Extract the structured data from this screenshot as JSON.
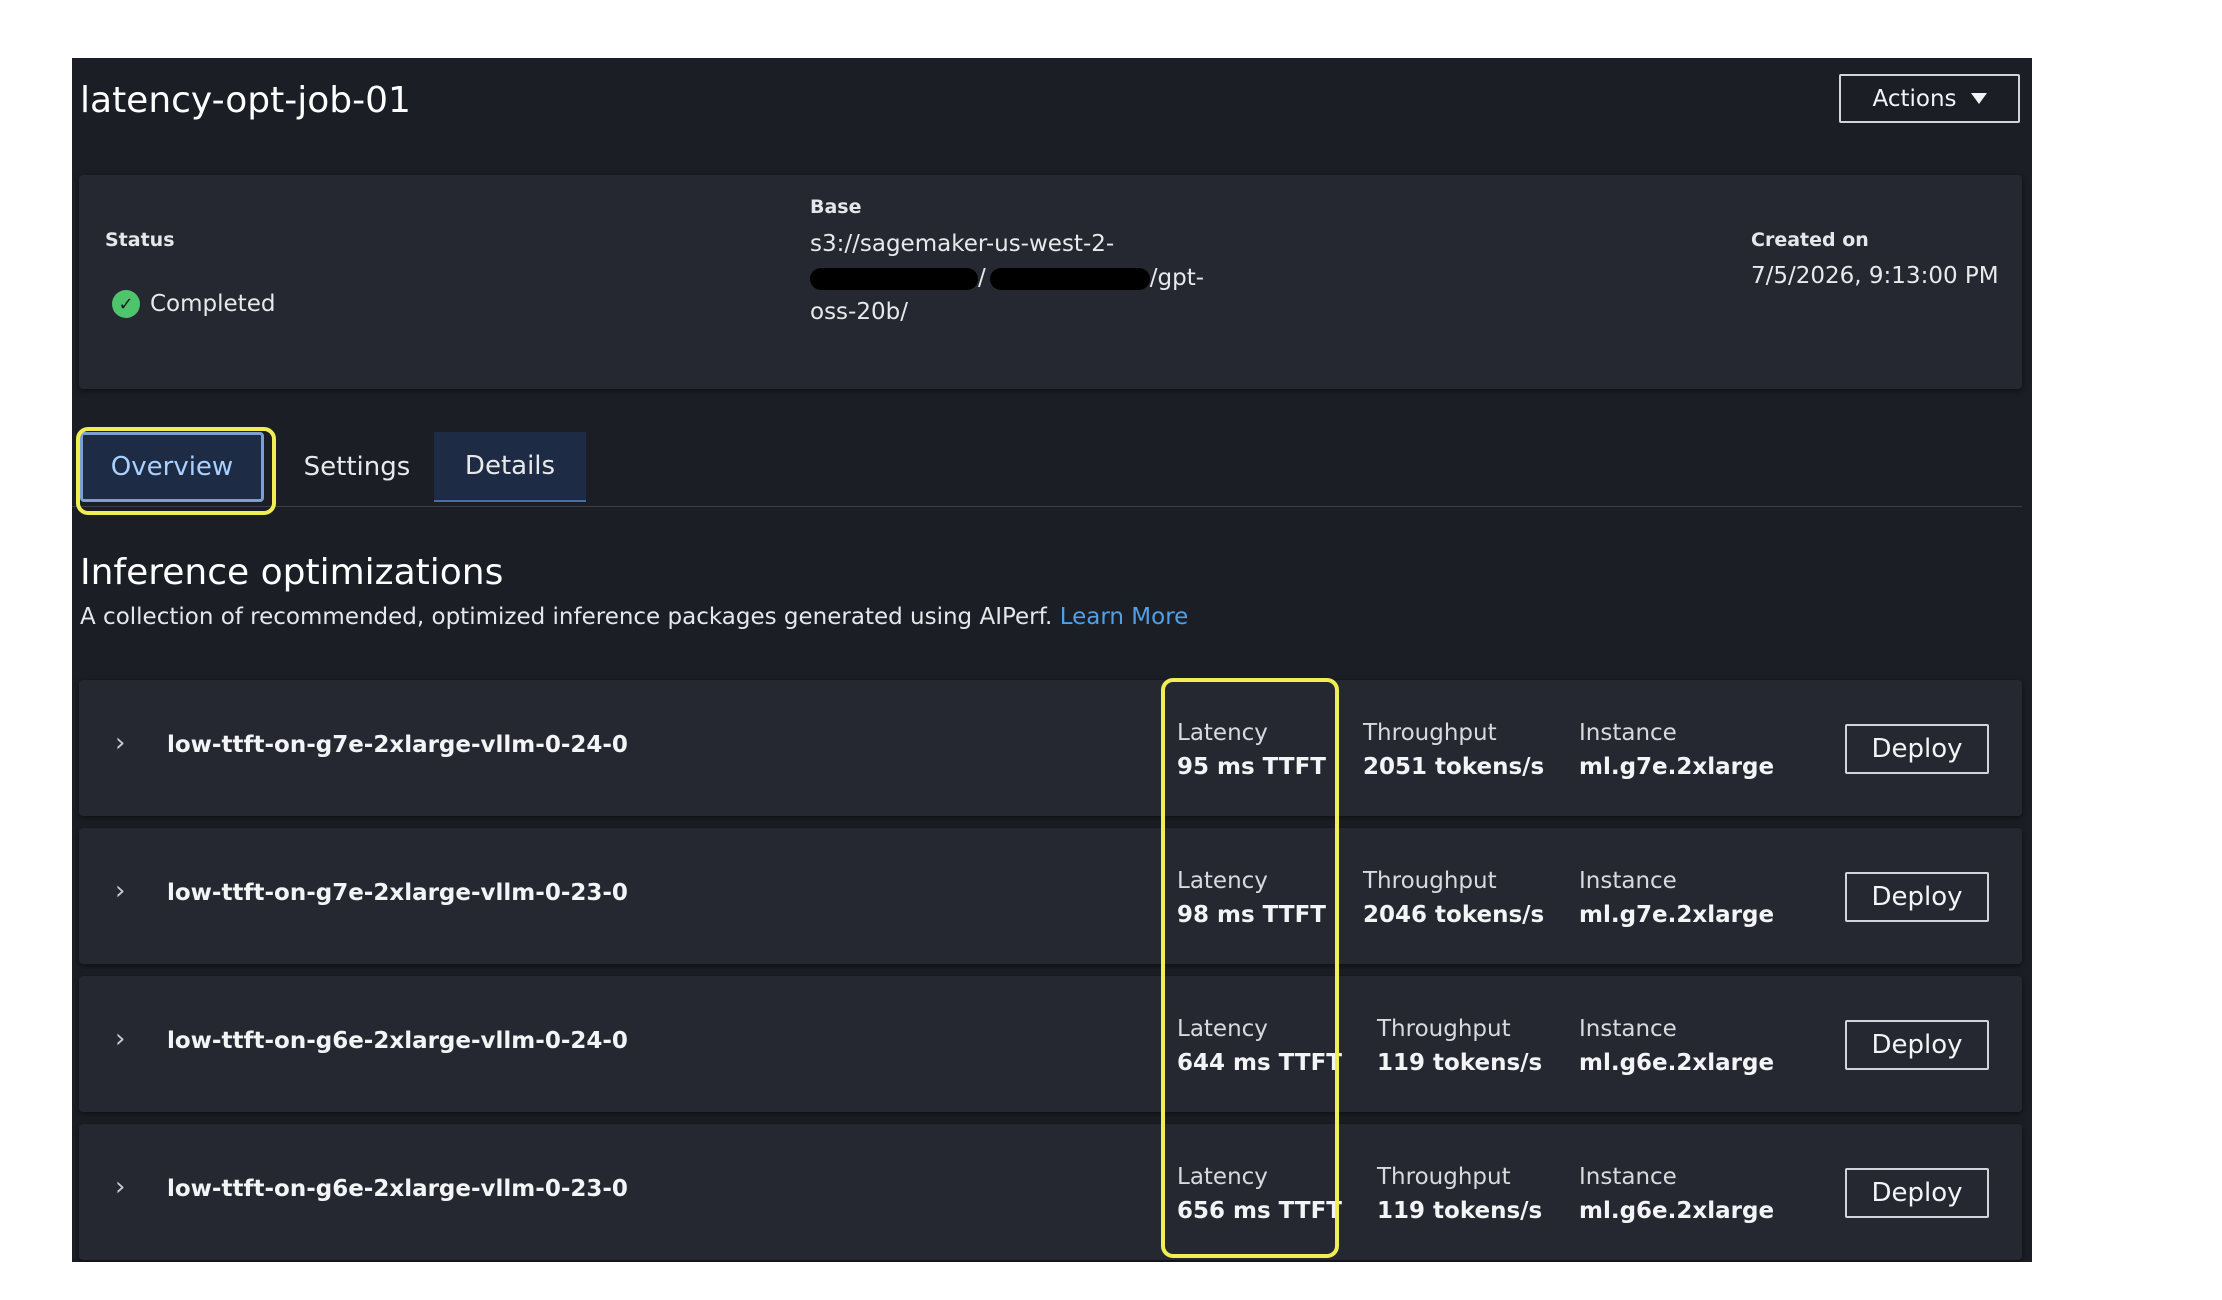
{
  "header": {
    "title": "latency-opt-job-01",
    "actions_label": "Actions"
  },
  "summary": {
    "status_label": "Status",
    "status_value": "Completed",
    "base_label": "Base",
    "base_line1": "s3://sagemaker-us-west-2-",
    "base_line2_sep": "/",
    "base_line2_end": "/gpt-",
    "base_line3": "oss-20b/",
    "created_label": "Created on",
    "created_value": "7/5/2026, 9:13:00 PM"
  },
  "tabs": [
    {
      "label": "Overview"
    },
    {
      "label": "Settings"
    },
    {
      "label": "Details"
    }
  ],
  "section": {
    "title": "Inference optimizations",
    "description": "A collection of recommended, optimized inference packages generated using AIPerf.",
    "learn_more": "Learn More"
  },
  "rows": [
    {
      "name": "low-ttft-on-g7e-2xlarge-vllm-0-24-0",
      "latency_label": "Latency",
      "latency": "95 ms TTFT",
      "throughput_label": "Throughput",
      "throughput": "2051 tokens/s",
      "instance_label": "Instance",
      "instance": "ml.g7e.2xlarge",
      "deploy_label": "Deploy"
    },
    {
      "name": "low-ttft-on-g7e-2xlarge-vllm-0-23-0",
      "latency_label": "Latency",
      "latency": "98 ms TTFT",
      "throughput_label": "Throughput",
      "throughput": "2046 tokens/s",
      "instance_label": "Instance",
      "instance": "ml.g7e.2xlarge",
      "deploy_label": "Deploy"
    },
    {
      "name": "low-ttft-on-g6e-2xlarge-vllm-0-24-0",
      "latency_label": "Latency",
      "latency": "644 ms TTFT",
      "throughput_label": "Throughput",
      "throughput": "119 tokens/s",
      "instance_label": "Instance",
      "instance": "ml.g6e.2xlarge",
      "deploy_label": "Deploy"
    },
    {
      "name": "low-ttft-on-g6e-2xlarge-vllm-0-23-0",
      "latency_label": "Latency",
      "latency": "656 ms TTFT",
      "throughput_label": "Throughput",
      "throughput": "119 tokens/s",
      "instance_label": "Instance",
      "instance": "ml.g6e.2xlarge",
      "deploy_label": "Deploy"
    }
  ],
  "colors": {
    "background": "#1b1e25",
    "panel": "#252831",
    "accent_link": "#539fe5",
    "highlight": "#f1ee53",
    "success": "#4ec46d"
  },
  "icons": {
    "status": "check-circle-icon",
    "expand": "chevron-right-icon",
    "actions": "caret-down-icon"
  }
}
